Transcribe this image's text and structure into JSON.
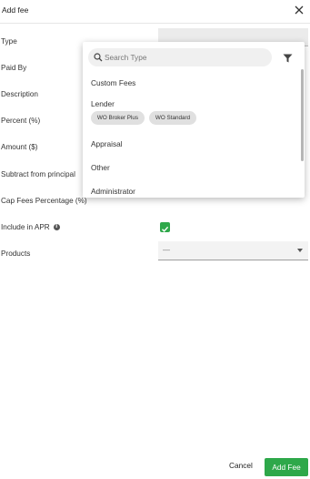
{
  "header": {
    "title": "Add fee"
  },
  "form": {
    "type_label": "Type",
    "paid_by_label": "Paid By",
    "description_label": "Description",
    "percent_label": "Percent (%)",
    "amount_label": "Amount ($)",
    "subtract_label": "Subtract from principal",
    "cap_fees_label": "Cap Fees Percentage (%)",
    "include_apr_label": "Include in APR",
    "include_apr_checked": true,
    "products_label": "Products",
    "products_value": "—"
  },
  "dropdown": {
    "search_placeholder": "Search Type",
    "items": [
      "Custom Fees",
      "Lender",
      "Appraisal",
      "Other",
      "Administrator"
    ],
    "lender_chips": [
      "WO Broker Plus",
      "WO Standard"
    ]
  },
  "footer": {
    "cancel_label": "Cancel",
    "add_label": "Add Fee"
  },
  "colors": {
    "accent": "#2ea84a"
  }
}
